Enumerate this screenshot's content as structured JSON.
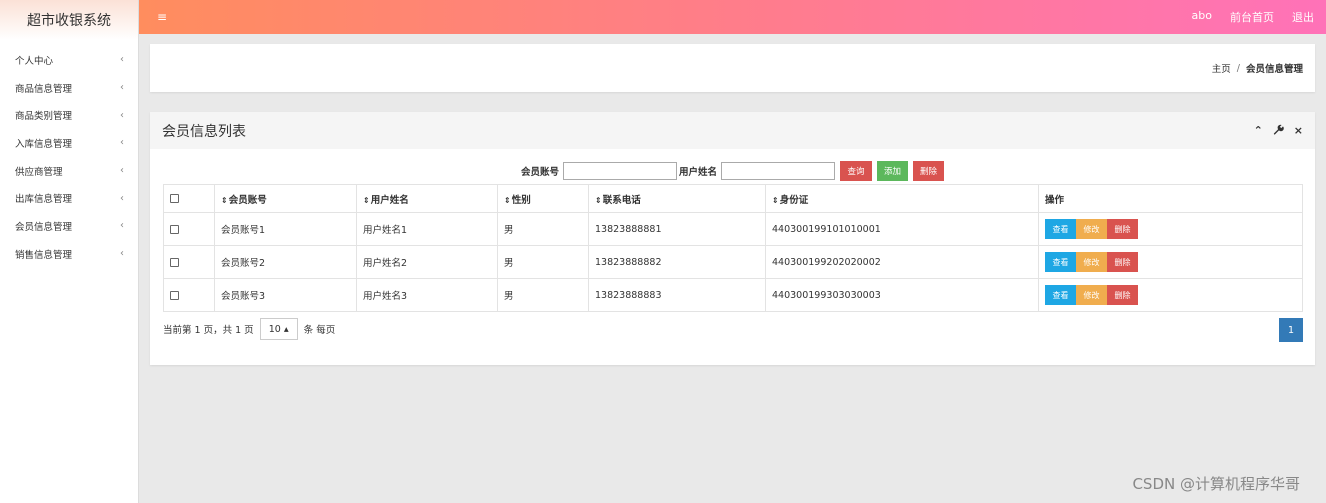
{
  "app": {
    "title": "超市收银系统"
  },
  "sidebar": {
    "items": [
      {
        "label": "个人中心"
      },
      {
        "label": "商品信息管理"
      },
      {
        "label": "商品类别管理"
      },
      {
        "label": "入库信息管理"
      },
      {
        "label": "供应商管理"
      },
      {
        "label": "出库信息管理"
      },
      {
        "label": "会员信息管理"
      },
      {
        "label": "销售信息管理"
      }
    ],
    "chevron": "‹"
  },
  "topbar": {
    "menu_icon": "≡",
    "user": "abo",
    "front_home": "前台首页",
    "logout": "退出"
  },
  "breadcrumb": {
    "home": "主页",
    "sep": "/",
    "current": "会员信息管理"
  },
  "panel": {
    "title": "会员信息列表",
    "tools": {
      "collapse": "⌃",
      "wrench": "🔧",
      "close": "×"
    }
  },
  "search": {
    "account_label": "会员账号",
    "account_value": "",
    "username_label": "用户姓名",
    "username_value": "",
    "query_button": "查询",
    "add_button": "添加",
    "delete_button": "删除"
  },
  "table": {
    "sort_glyph": "⇕",
    "columns": [
      "会员账号",
      "用户姓名",
      "性别",
      "联系电话",
      "身份证"
    ],
    "ops_header": "操作",
    "rows": [
      {
        "account": "会员账号1",
        "name": "用户姓名1",
        "gender": "男",
        "phone": "13823888881",
        "idcard": "440300199101010001"
      },
      {
        "account": "会员账号2",
        "name": "用户姓名2",
        "gender": "男",
        "phone": "13823888882",
        "idcard": "440300199202020002"
      },
      {
        "account": "会员账号3",
        "name": "用户姓名3",
        "gender": "男",
        "phone": "13823888883",
        "idcard": "440300199303030003"
      }
    ],
    "op_view": "查看",
    "op_edit": "修改",
    "op_delete": "删除"
  },
  "pager": {
    "summary": "当前第 1 页，共 1 页",
    "page_size": "10 ▴",
    "per_page_suffix": "条 每页",
    "current_page": "1"
  },
  "watermark": "CSDN @计算机程序华哥",
  "colors": {
    "topbar_start": "#ff8d5e",
    "topbar_end": "#ff72b8",
    "btn_view": "#1ea7e4",
    "btn_edit": "#f0ad4e",
    "btn_delete": "#d9534f",
    "btn_add": "#5cb85c",
    "page_active": "#337ab7"
  }
}
